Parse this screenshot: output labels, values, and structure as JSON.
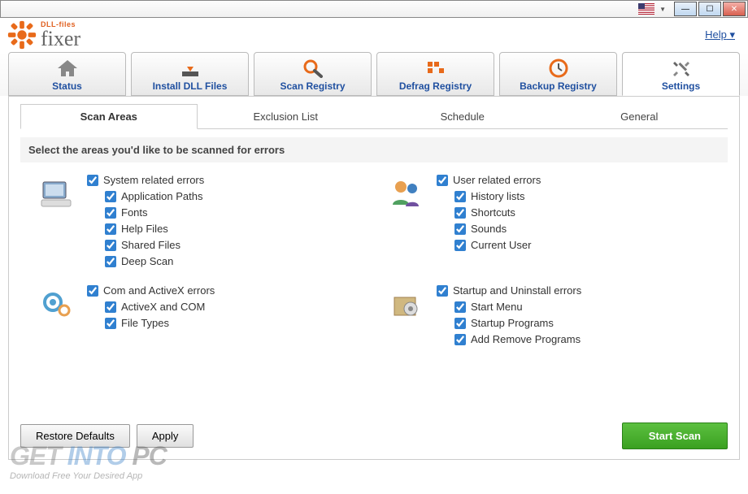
{
  "help_label": "Help",
  "logo": {
    "dll": "DLL-files",
    "fixer": "fixer"
  },
  "main_tabs": [
    {
      "label": "Status"
    },
    {
      "label": "Install DLL Files"
    },
    {
      "label": "Scan Registry"
    },
    {
      "label": "Defrag Registry"
    },
    {
      "label": "Backup Registry"
    },
    {
      "label": "Settings"
    }
  ],
  "sub_tabs": [
    {
      "label": "Scan Areas"
    },
    {
      "label": "Exclusion List"
    },
    {
      "label": "Schedule"
    },
    {
      "label": "General"
    }
  ],
  "instruction": "Select the areas you'd like to be scanned for errors",
  "groups": {
    "system": {
      "title": "System related errors",
      "items": [
        "Application Paths",
        "Fonts",
        "Help Files",
        "Shared Files",
        "Deep Scan"
      ]
    },
    "user": {
      "title": "User related errors",
      "items": [
        "History lists",
        "Shortcuts",
        "Sounds",
        "Current User"
      ]
    },
    "com": {
      "title": "Com and ActiveX errors",
      "items": [
        "ActiveX and COM",
        "File Types"
      ]
    },
    "startup": {
      "title": "Startup and Uninstall errors",
      "items": [
        "Start Menu",
        "Startup Programs",
        "Add Remove Programs"
      ]
    }
  },
  "buttons": {
    "restore": "Restore Defaults",
    "apply": "Apply",
    "start": "Start Scan"
  },
  "watermark": {
    "get": "GET",
    "into": "INTO",
    "pc": "PC",
    "tag": "Download Free Your Desired App"
  }
}
